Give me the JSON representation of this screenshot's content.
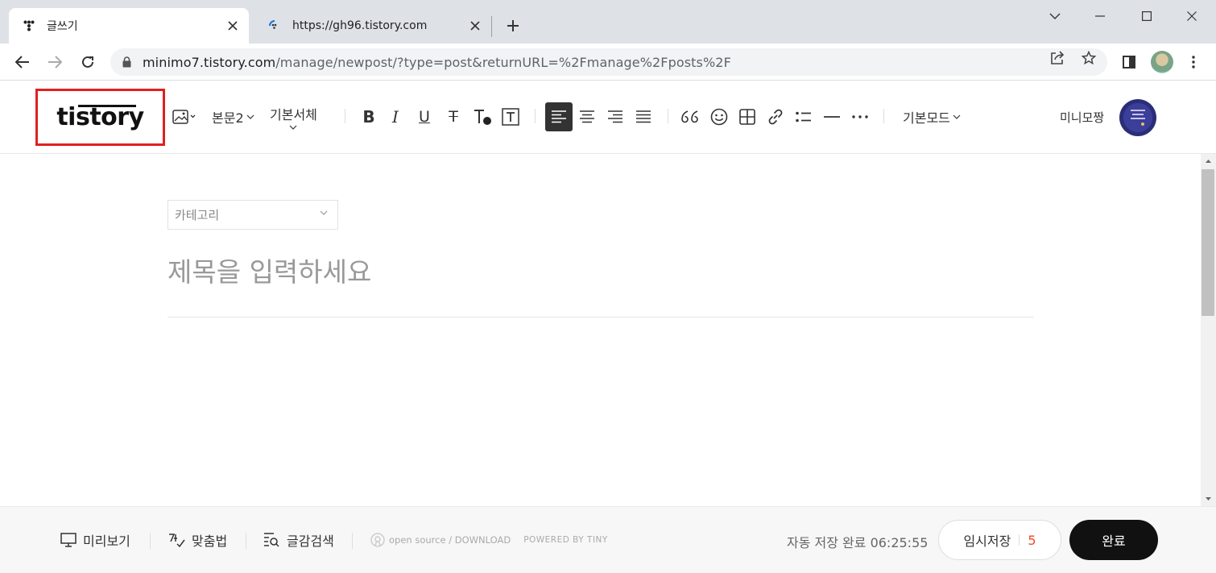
{
  "browser": {
    "tabs": [
      {
        "title": "글쓰기",
        "active": true
      },
      {
        "title": "https://gh96.tistory.com",
        "active": false
      }
    ],
    "url_host": "minimo7.tistory.com",
    "url_path": "/manage/newpost/?type=post&returnURL=%2Fmanage%2Fposts%2F"
  },
  "editor": {
    "logo": "tistory",
    "toolbar": {
      "paragraph_style": "본문2",
      "font": "기본서체",
      "mode": "기본모드"
    },
    "username": "미니모짱"
  },
  "content": {
    "category_placeholder": "카테고리",
    "title_placeholder": "제목을 입력하세요"
  },
  "footer": {
    "preview": "미리보기",
    "spellcheck": "맞춤법",
    "search": "글감검색",
    "tiny_open_source": "open source / DOWNLOAD",
    "tiny_powered": "POWERED BY TINY",
    "autosave_text": "자동 저장 완료 06:25:55",
    "draft_label": "임시저장",
    "draft_count": "5",
    "done_label": "완료"
  },
  "colors": {
    "highlight_box": "#e02020",
    "draft_count": "#f04a23",
    "done_button": "#111111"
  }
}
